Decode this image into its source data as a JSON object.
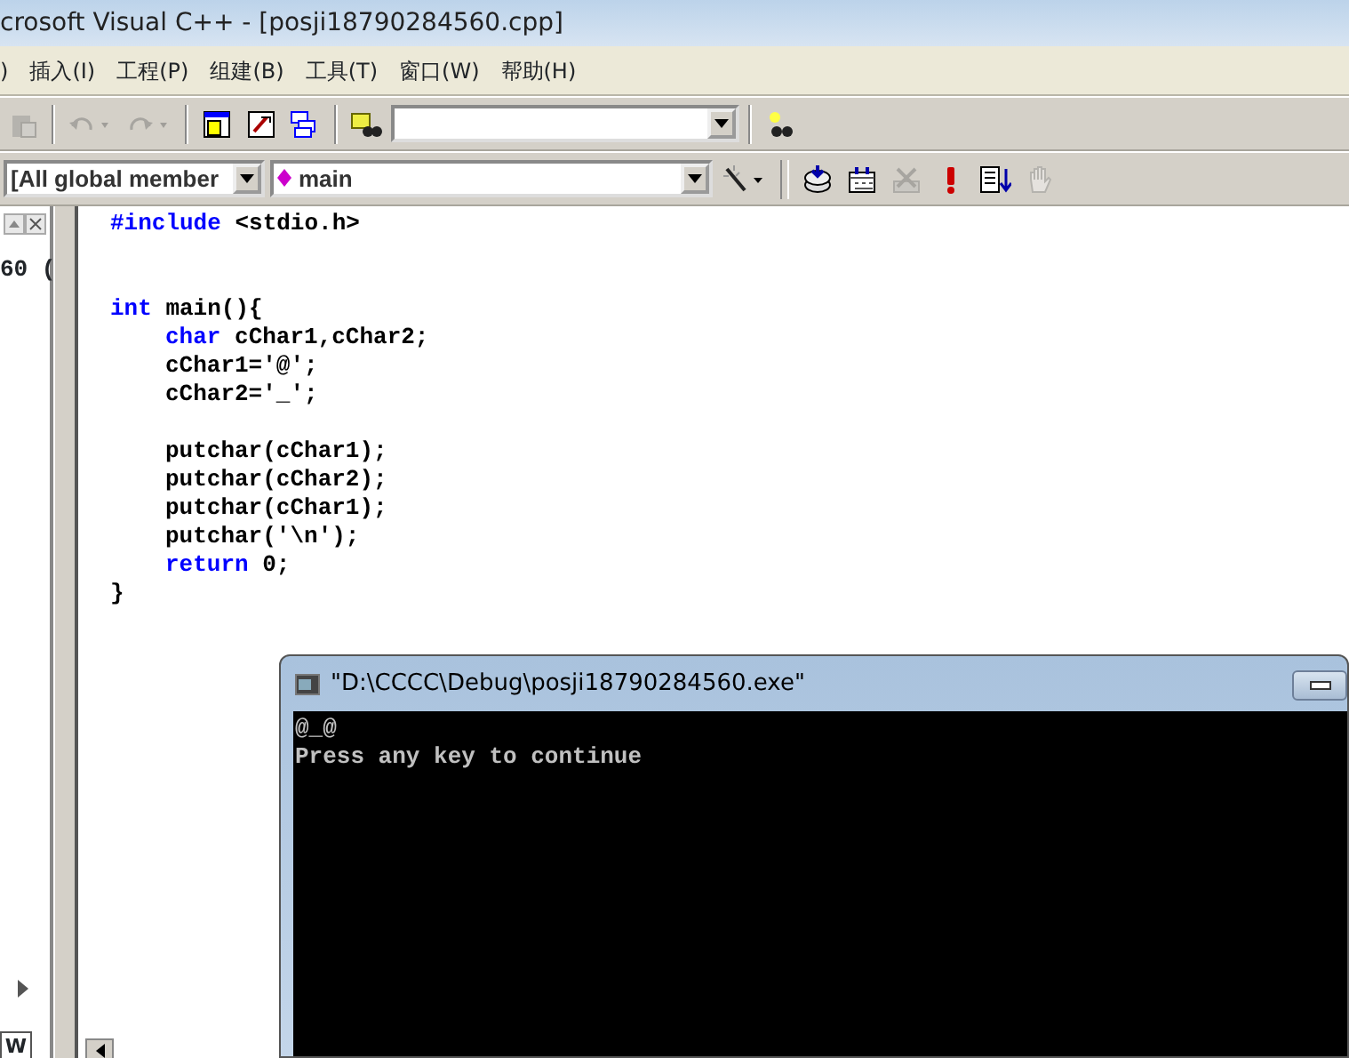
{
  "window": {
    "title": "crosoft Visual C++ - [posji18790284560.cpp]"
  },
  "menu": [
    {
      "label": ")"
    },
    {
      "label": "插入(I)"
    },
    {
      "label": "工程(P)"
    },
    {
      "label": "组建(B)"
    },
    {
      "label": "工具(T)"
    },
    {
      "label": "窗口(W)"
    },
    {
      "label": "帮助(H)"
    }
  ],
  "toolbar_1": [
    {
      "kind": "paste",
      "disabled": true
    },
    {
      "kind": "sep"
    },
    {
      "kind": "undo",
      "disabled": true
    },
    {
      "kind": "redo",
      "disabled": true
    },
    {
      "kind": "sep"
    },
    {
      "kind": "workspace",
      "disabled": false
    },
    {
      "kind": "output",
      "disabled": false
    },
    {
      "kind": "windows",
      "disabled": false
    },
    {
      "kind": "sep"
    },
    {
      "kind": "find-files",
      "disabled": false
    },
    {
      "kind": "combo"
    },
    {
      "kind": "sep"
    },
    {
      "kind": "find",
      "disabled": false
    }
  ],
  "toolbar_2": [
    {
      "kind": "combo",
      "value": "[All global member"
    },
    {
      "kind": "combo-main",
      "value": "main"
    },
    {
      "kind": "wizard",
      "disabled": false
    },
    {
      "kind": "grip"
    },
    {
      "kind": "compile",
      "disabled": false
    },
    {
      "kind": "build",
      "disabled": false
    },
    {
      "kind": "stop",
      "disabled": true
    },
    {
      "kind": "execute",
      "disabled": false
    },
    {
      "kind": "go",
      "disabled": false
    },
    {
      "kind": "hand",
      "disabled": true
    }
  ],
  "side_panel": {
    "text": "60 (",
    "tab": "W"
  },
  "editor": {
    "lines": [
      {
        "kind": "code",
        "tokens": [
          {
            "kind": "keyword",
            "text": "#include"
          },
          {
            "kind": "plain",
            "text": " <stdio.h>"
          }
        ]
      },
      {
        "kind": "blank"
      },
      {
        "kind": "blank"
      },
      {
        "kind": "code",
        "tokens": [
          {
            "kind": "keyword",
            "text": "int"
          },
          {
            "kind": "plain",
            "text": " main(){"
          }
        ],
        "children": [
          {
            "kind": "code",
            "tokens": [
              {
                "kind": "keyword",
                "text": "char"
              },
              {
                "kind": "plain",
                "text": " cChar1,cChar2;"
              }
            ]
          },
          {
            "kind": "code",
            "tokens": [
              {
                "kind": "plain",
                "text": "cChar1='@';"
              }
            ]
          },
          {
            "kind": "code",
            "tokens": [
              {
                "kind": "plain",
                "text": "cChar2='_';"
              }
            ]
          },
          {
            "kind": "blank"
          },
          {
            "kind": "code",
            "tokens": [
              {
                "kind": "plain",
                "text": "putchar(cChar1);"
              }
            ]
          },
          {
            "kind": "code",
            "tokens": [
              {
                "kind": "plain",
                "text": "putchar(cChar2);"
              }
            ]
          },
          {
            "kind": "code",
            "tokens": [
              {
                "kind": "plain",
                "text": "putchar(cChar1);"
              }
            ]
          },
          {
            "kind": "code",
            "tokens": [
              {
                "kind": "plain",
                "text": "putchar('\\n');"
              }
            ]
          },
          {
            "kind": "code",
            "tokens": [
              {
                "kind": "keyword",
                "text": "return"
              },
              {
                "kind": "plain",
                "text": " 0;"
              }
            ]
          }
        ]
      },
      {
        "kind": "code",
        "tokens": [
          {
            "kind": "plain",
            "text": "}"
          }
        ]
      }
    ]
  },
  "console": {
    "title": "\"D:\\CCCC\\Debug\\posji18790284560.exe\"",
    "lines": [
      "@_@",
      "Press any key to continue"
    ]
  }
}
